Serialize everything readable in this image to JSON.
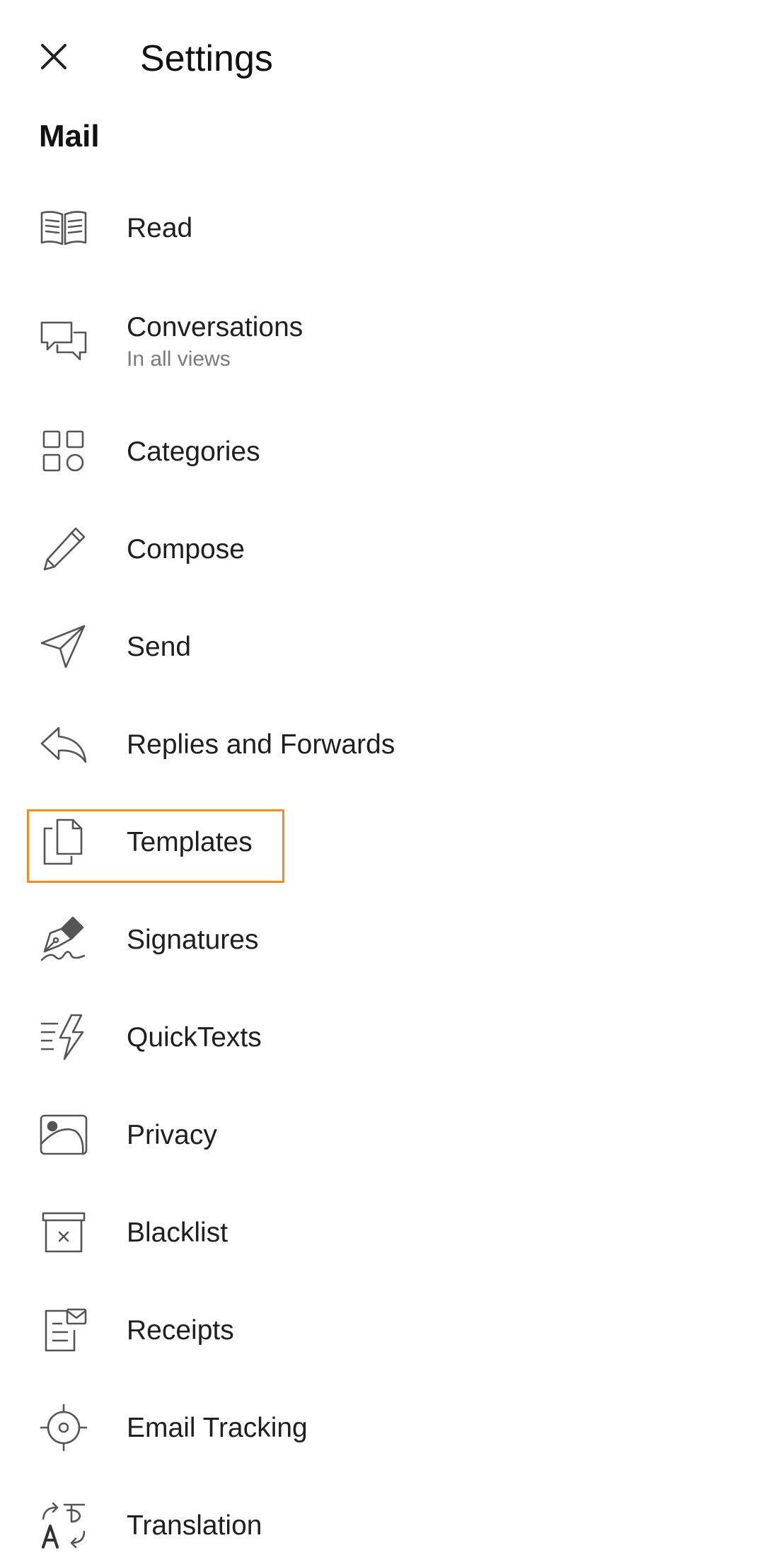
{
  "header": {
    "title": "Settings",
    "close_icon": "close-icon"
  },
  "section": {
    "title": "Mail"
  },
  "items": [
    {
      "label": "Read",
      "icon": "book-icon"
    },
    {
      "label": "Conversations",
      "sublabel": "In all views",
      "icon": "chat-bubbles-icon"
    },
    {
      "label": "Categories",
      "icon": "grid-shapes-icon"
    },
    {
      "label": "Compose",
      "icon": "pencil-icon"
    },
    {
      "label": "Send",
      "icon": "paper-plane-icon"
    },
    {
      "label": "Replies and Forwards",
      "icon": "reply-icon"
    },
    {
      "label": "Templates",
      "icon": "documents-icon"
    },
    {
      "label": "Signatures",
      "icon": "pen-signature-icon"
    },
    {
      "label": "QuickTexts",
      "icon": "lightning-text-icon"
    },
    {
      "label": "Privacy",
      "icon": "image-icon"
    },
    {
      "label": "Blacklist",
      "icon": "archive-x-icon"
    },
    {
      "label": "Receipts",
      "icon": "receipt-mail-icon"
    },
    {
      "label": "Email Tracking",
      "icon": "target-icon"
    },
    {
      "label": "Translation",
      "icon": "translate-icon"
    }
  ],
  "colors": {
    "highlight": "#f28c1a",
    "icon_stroke": "#555555",
    "sublabel": "#7a7a7a"
  }
}
